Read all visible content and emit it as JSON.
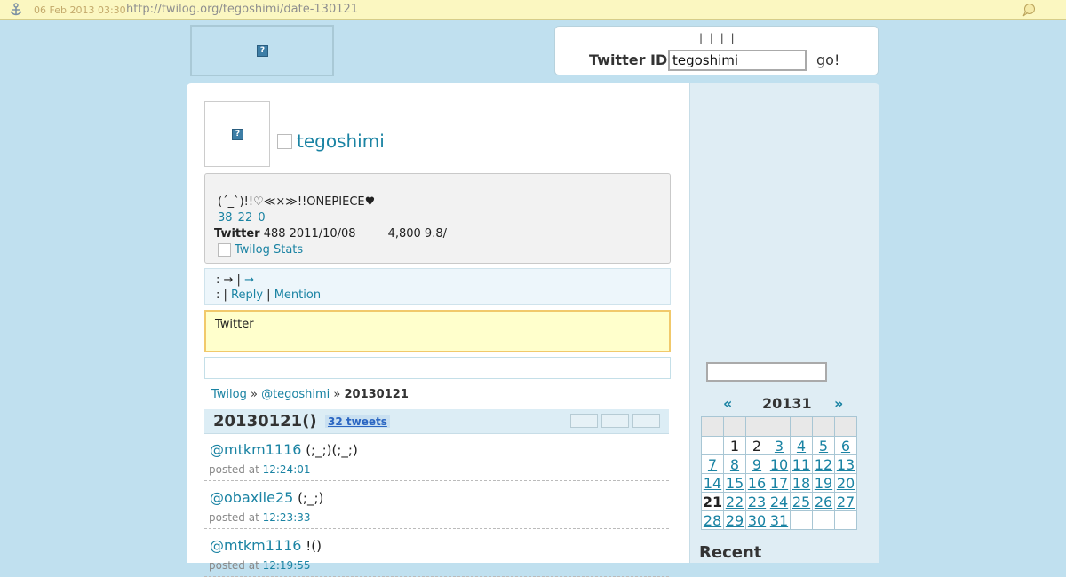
{
  "archive": {
    "date": "06 Feb 2013 03:30",
    "url": "http://twilog.org/tegoshimi/date-130121"
  },
  "header": {
    "bars": "| | | |",
    "twitter_id_label": "Twitter ID",
    "twitter_id_value": "tegoshimi",
    "go": "go!"
  },
  "profile": {
    "username": "tegoshimi",
    "bio": "(´_`)!!♡≪×≫!!ONEPIECE♥",
    "counts": "38  22  0",
    "twitter_label": "Twitter",
    "twitter_info": " 488 2011/10/08",
    "avg": "4,800 9.8/",
    "stats_link": "Twilog Stats"
  },
  "nav": {
    "line1_prefix": ": → | ",
    "line1_link": "→",
    "line2_prefix": ":  | ",
    "reply": "Reply",
    "sep": " | ",
    "mention": "Mention"
  },
  "notice": "Twitter",
  "breadcrumb": {
    "home": "Twilog",
    "sep1": " » ",
    "user": "@tegoshimi",
    "sep2": " » ",
    "current": "20130121"
  },
  "date_header": {
    "title": "20130121()",
    "count": "32 tweets"
  },
  "tweets": [
    {
      "user": "@mtkm1116",
      "text": " (;_;)(;_;)",
      "posted": "posted at ",
      "time": "12:24:01"
    },
    {
      "user": "@obaxile25",
      "text": " (;_;)",
      "posted": "posted at ",
      "time": "12:23:33"
    },
    {
      "user": "@mtkm1116",
      "text": " !()",
      "posted": "posted at ",
      "time": "12:19:55"
    }
  ],
  "calendar": {
    "prev": "«",
    "month": "20131",
    "next": "»",
    "weeks": [
      [
        "",
        "1",
        "2",
        "3",
        "4",
        "5",
        "6"
      ],
      [
        "7",
        "8",
        "9",
        "10",
        "11",
        "12",
        "13"
      ],
      [
        "14",
        "15",
        "16",
        "17",
        "18",
        "19",
        "20"
      ],
      [
        "21",
        "22",
        "23",
        "24",
        "25",
        "26",
        "27"
      ],
      [
        "28",
        "29",
        "30",
        "31",
        "",
        "",
        ""
      ]
    ],
    "plain_days": [
      "1",
      "2"
    ],
    "current_day": "21"
  },
  "sidebar": {
    "recent": "Recent"
  },
  "colors": {
    "link": "#1a83a3",
    "background": "#c0e0ef",
    "notice_bg": "#ffffcc",
    "notice_border": "#f1c96b"
  },
  "icons": {
    "broken_image": "broken-image-icon",
    "archive_anchor": "anchor-icon",
    "archive_info": "info-icon"
  }
}
